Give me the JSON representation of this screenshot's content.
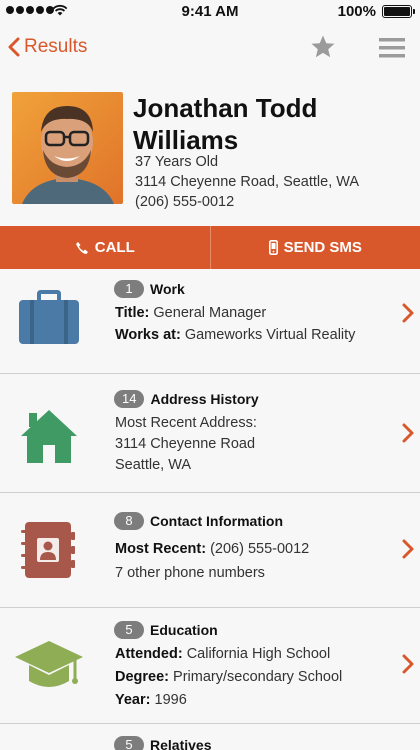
{
  "status_bar": {
    "time": "9:41 AM",
    "battery": "100%"
  },
  "nav": {
    "back_label": "Results"
  },
  "profile": {
    "name_line1": "Jonathan Todd",
    "name_line2": "Williams",
    "age": "37 Years Old",
    "address": "3114 Cheyenne Road, Seattle, WA",
    "phone": "(206) 555-0012"
  },
  "actions": {
    "call_label": "CALL",
    "sms_label": "SEND SMS"
  },
  "colors": {
    "accent": "#d9582b",
    "work_icon": "#4a7aa5",
    "home_icon": "#3f9a63",
    "contact_icon": "#a8584a",
    "education_icon": "#8fad55",
    "badge": "#7d7d7d"
  },
  "sections": {
    "work": {
      "icon": "briefcase-icon",
      "count": "1",
      "title": "Work",
      "title_label": "Title:",
      "title_value": "General Manager",
      "works_label": "Works at:",
      "works_value": "Gameworks Virtual Reality"
    },
    "address": {
      "icon": "house-icon",
      "count": "14",
      "title": "Address History",
      "recent_label": "Most Recent Address:",
      "street": "3114 Cheyenne Road",
      "city": "Seattle, WA"
    },
    "contact": {
      "icon": "address-book-icon",
      "count": "8",
      "title": "Contact Information",
      "recent_label": "Most Recent:",
      "recent_value": "(206) 555-0012",
      "other": "7 other phone numbers"
    },
    "education": {
      "icon": "graduation-cap-icon",
      "count": "5",
      "title": "Education",
      "attended_label": "Attended:",
      "attended_value": "California High School",
      "degree_label": "Degree:",
      "degree_value": "Primary/secondary School",
      "year_label": "Year:",
      "year_value": "1996"
    },
    "relatives": {
      "count": "5",
      "title": "Relatives"
    }
  }
}
